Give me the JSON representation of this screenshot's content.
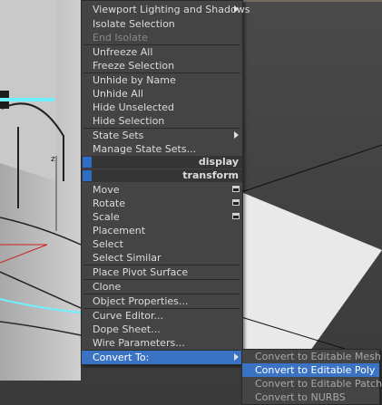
{
  "quad_top_left": {
    "items": [
      {
        "label": "Viewport Lighting and Shadows",
        "submenu": true
      },
      {
        "label": "Isolate Selection"
      },
      {
        "label": "End Isolate",
        "disabled": true
      },
      {
        "label": "Unfreeze All"
      },
      {
        "label": "Freeze Selection"
      },
      {
        "label": "Unhide by Name"
      },
      {
        "label": "Unhide All"
      },
      {
        "label": "Hide Unselected"
      },
      {
        "label": "Hide Selection"
      },
      {
        "label": "State Sets",
        "submenu": true
      },
      {
        "label": "Manage State Sets..."
      }
    ],
    "header": "display"
  },
  "quad_bottom_left": {
    "header": "transform",
    "items": [
      {
        "label": "Move",
        "settings_icon": true
      },
      {
        "label": "Rotate",
        "settings_icon": true
      },
      {
        "label": "Scale",
        "settings_icon": true
      },
      {
        "label": "Placement"
      },
      {
        "label": "Select"
      },
      {
        "label": "Select Similar"
      },
      {
        "label": "Place Pivot Surface"
      },
      {
        "label": "Clone"
      },
      {
        "label": "Object Properties..."
      },
      {
        "label": "Curve Editor..."
      },
      {
        "label": "Dope Sheet..."
      },
      {
        "label": "Wire Parameters..."
      },
      {
        "label": "Convert To:",
        "submenu": true,
        "highlighted": true
      }
    ]
  },
  "convert_submenu": {
    "items": [
      {
        "label": "Convert to Editable Mesh"
      },
      {
        "label": "Convert to Editable Poly",
        "highlighted": true
      },
      {
        "label": "Convert to Editable Patch"
      },
      {
        "label": "Convert to NURBS"
      }
    ]
  },
  "viewport": {
    "axis_label": "z",
    "accent_color": "#3a73c4",
    "selection_color": "#6ff0ff"
  }
}
